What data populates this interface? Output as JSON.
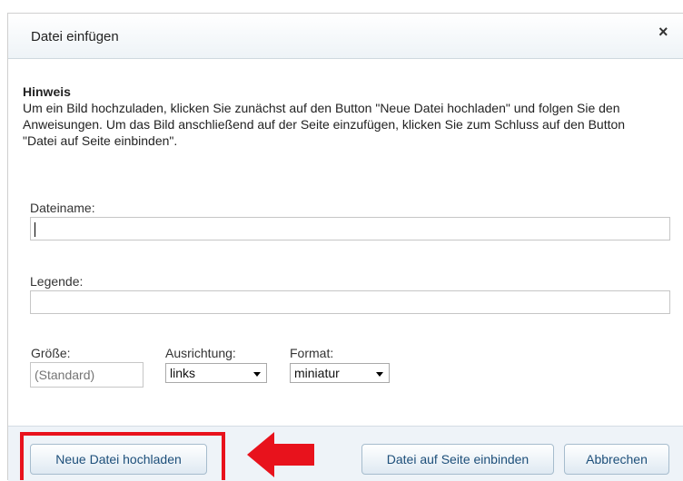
{
  "dialog": {
    "title": "Datei einfügen",
    "close_symbol": "×"
  },
  "hint": {
    "title": "Hinweis",
    "text": "Um ein Bild hochzuladen, klicken Sie zunächst auf den Button \"Neue Datei hochladen\" und folgen Sie den Anweisungen. Um das Bild anschließend auf der Seite einzufügen, klicken Sie zum Schluss auf den Button \"Datei auf Seite einbinden\"."
  },
  "form": {
    "filename_label": "Dateiname:",
    "filename_value": "",
    "caption_label": "Legende:",
    "caption_value": "",
    "size_label": "Größe:",
    "size_placeholder": "(Standard)",
    "alignment_label": "Ausrichtung:",
    "alignment_value": "links",
    "format_label": "Format:",
    "format_value": "miniatur"
  },
  "buttons": {
    "upload": "Neue Datei hochladen",
    "embed": "Datei auf Seite einbinden",
    "cancel": "Abbrechen"
  },
  "annotation": {
    "highlight_color": "#e8121c"
  }
}
